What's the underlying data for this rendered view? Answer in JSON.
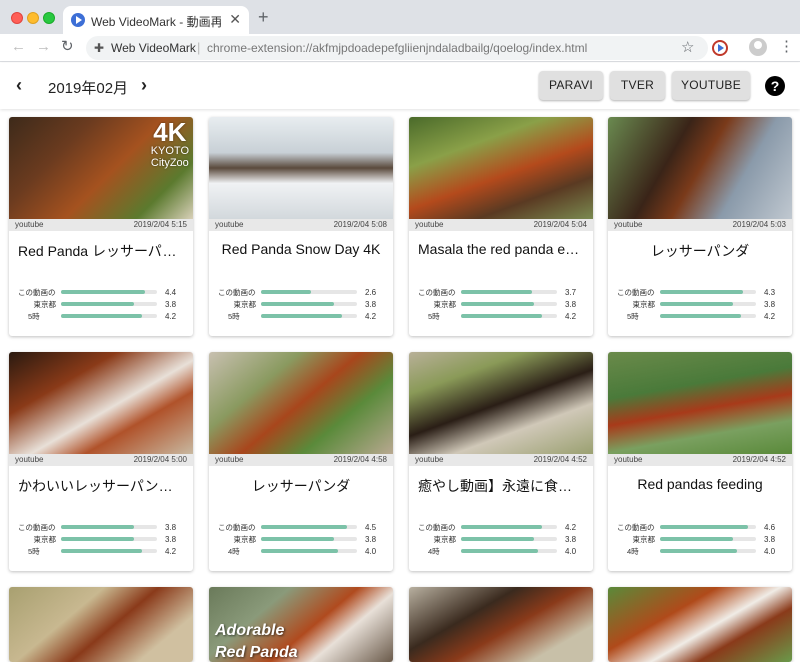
{
  "browser": {
    "tab_title": "Web VideoMark - 動画再生品質記録",
    "close_glyph": "✕",
    "new_tab_glyph": "+",
    "back_glyph": "←",
    "forward_glyph": "→",
    "reload_glyph": "↻",
    "extension_name": "Web VideoMark",
    "url": "chrome-extension://akfmjpdoadepefgliienjndaladbailg/qoelog/index.html",
    "star_glyph": "☆",
    "menu_glyph": "⋮"
  },
  "header": {
    "prev_glyph": "‹",
    "month": "2019年02月",
    "next_glyph": "›",
    "buttons": [
      "PARAVI",
      "TVER",
      "YOUTUBE"
    ],
    "help_glyph": "?"
  },
  "colors": {
    "bar_fill": "#7cc2a8",
    "bar_track": "#e6e6e6"
  },
  "cards": [
    {
      "service": "youtube",
      "time": "2019/2/04 5:15",
      "title": "Red Panda レッサーパンダ",
      "thumb_caption": {
        "big": "4K",
        "small1": "KYOTO",
        "small2": "CityZoo"
      },
      "stats": [
        {
          "label": "この動画の平均",
          "value": "4.4",
          "level": 0.88
        },
        {
          "label": "東京都",
          "value": "3.8",
          "level": 0.76
        },
        {
          "label": "5時",
          "value": "4.2",
          "level": 0.84
        }
      ]
    },
    {
      "service": "youtube",
      "time": "2019/2/04 5:08",
      "title": "Red Panda Snow Day 4K",
      "stats": [
        {
          "label": "この動画の平均",
          "value": "2.6",
          "level": 0.52
        },
        {
          "label": "東京都",
          "value": "3.8",
          "level": 0.76
        },
        {
          "label": "5時",
          "value": "4.2",
          "level": 0.84
        }
      ]
    },
    {
      "service": "youtube",
      "time": "2019/2/04 5:04",
      "title": "Masala the red panda eats bamboo",
      "stats": [
        {
          "label": "この動画の平均",
          "value": "3.7",
          "level": 0.74
        },
        {
          "label": "東京都",
          "value": "3.8",
          "level": 0.76
        },
        {
          "label": "5時",
          "value": "4.2",
          "level": 0.84
        }
      ]
    },
    {
      "service": "youtube",
      "time": "2019/2/04 5:03",
      "title": "レッサーパンダ",
      "stats": [
        {
          "label": "この動画の平均",
          "value": "4.3",
          "level": 0.86
        },
        {
          "label": "東京都",
          "value": "3.8",
          "level": 0.76
        },
        {
          "label": "5時",
          "value": "4.2",
          "level": 0.84
        }
      ]
    },
    {
      "service": "youtube",
      "time": "2019/2/04 5:00",
      "title": "かわいいレッサーパンダの寝顔",
      "stats": [
        {
          "label": "この動画の平均",
          "value": "3.8",
          "level": 0.76
        },
        {
          "label": "東京都",
          "value": "3.8",
          "level": 0.76
        },
        {
          "label": "5時",
          "value": "4.2",
          "level": 0.84
        }
      ]
    },
    {
      "service": "youtube",
      "time": "2019/2/04 4:58",
      "title": "レッサーパンダ",
      "stats": [
        {
          "label": "この動画の平均",
          "value": "4.5",
          "level": 0.9
        },
        {
          "label": "東京都",
          "value": "3.8",
          "level": 0.76
        },
        {
          "label": "4時",
          "value": "4.0",
          "level": 0.8
        }
      ]
    },
    {
      "service": "youtube",
      "time": "2019/2/04 4:52",
      "title": "癒やし動画】永遠に食べるレッサーパンダ",
      "stats": [
        {
          "label": "この動画の平均",
          "value": "4.2",
          "level": 0.84
        },
        {
          "label": "東京都",
          "value": "3.8",
          "level": 0.76
        },
        {
          "label": "4時",
          "value": "4.0",
          "level": 0.8
        }
      ]
    },
    {
      "service": "youtube",
      "time": "2019/2/04 4:52",
      "title": "Red pandas feeding",
      "stats": [
        {
          "label": "この動画の平均",
          "value": "4.6",
          "level": 0.92
        },
        {
          "label": "東京都",
          "value": "3.8",
          "level": 0.76
        },
        {
          "label": "4時",
          "value": "4.0",
          "level": 0.8
        }
      ]
    }
  ],
  "bottom_row": {
    "overlay_line1": "Adorable",
    "overlay_line2": "Red Panda"
  }
}
